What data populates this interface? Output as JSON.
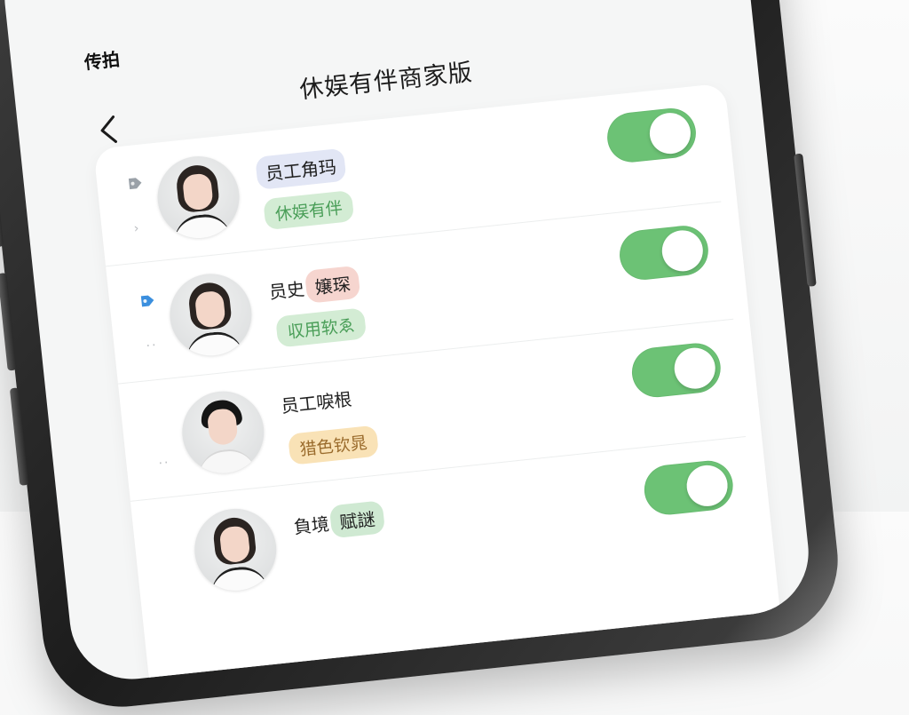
{
  "status_bar": {
    "time": "传拍"
  },
  "header": {
    "title": "休娱有伴商家版",
    "back_icon": "chevron-left-icon"
  },
  "staff": [
    {
      "name": "员工",
      "role": "角玛",
      "tag": "休娱有伴",
      "tag_color": "green",
      "enabled": true,
      "marker": "tag-gray",
      "sub": "›"
    },
    {
      "name": "员史",
      "role": "嬢琛",
      "tag": "収用软ゑ",
      "tag_color": "green",
      "enabled": true,
      "marker": "tag-blue",
      "sub": "··"
    },
    {
      "name": "员工唳根",
      "role": "",
      "tag": "猎色钦晁",
      "tag_color": "yellow",
      "enabled": true,
      "marker": "",
      "sub": "··"
    },
    {
      "name": "負境",
      "role": "赋謎",
      "tag": "",
      "tag_color": "green",
      "enabled": true,
      "marker": "",
      "sub": ""
    }
  ],
  "colors": {
    "toggle_on": "#6cc275",
    "tag_green_bg": "#d3ecd4",
    "tag_yellow_bg": "#f9e2b6",
    "role_bg": "#e2e6f5"
  }
}
